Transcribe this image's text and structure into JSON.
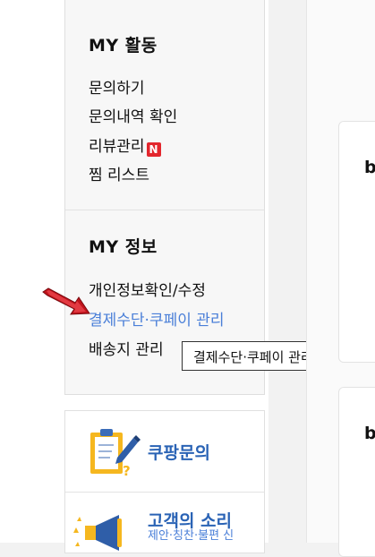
{
  "my_activity": {
    "title": "MY 활동",
    "items": [
      "문의하기",
      "문의내역 확인",
      "리뷰관리",
      "찜 리스트"
    ],
    "new_badge": "N"
  },
  "my_info": {
    "title": "MY 정보",
    "items": [
      "개인정보확인/수정",
      "결제수단·쿠페이 관리",
      "배송지 관리"
    ]
  },
  "tooltip": {
    "text": "결제수단·쿠페이 관리"
  },
  "help_cards": [
    {
      "title": "쿠팡문의",
      "icon": "inquiry-clipboard-icon"
    },
    {
      "title": "고객의 소리",
      "subtitle": "제안·칭찬·불편 신",
      "icon": "megaphone-icon"
    }
  ],
  "right_cards": [
    {
      "letter": "b"
    },
    {
      "letter": "b"
    }
  ],
  "colors": {
    "link_active": "#4a7fd8",
    "card_title": "#2a63b5",
    "badge_red": "#e3262d",
    "arrow_red": "#c0141c"
  }
}
